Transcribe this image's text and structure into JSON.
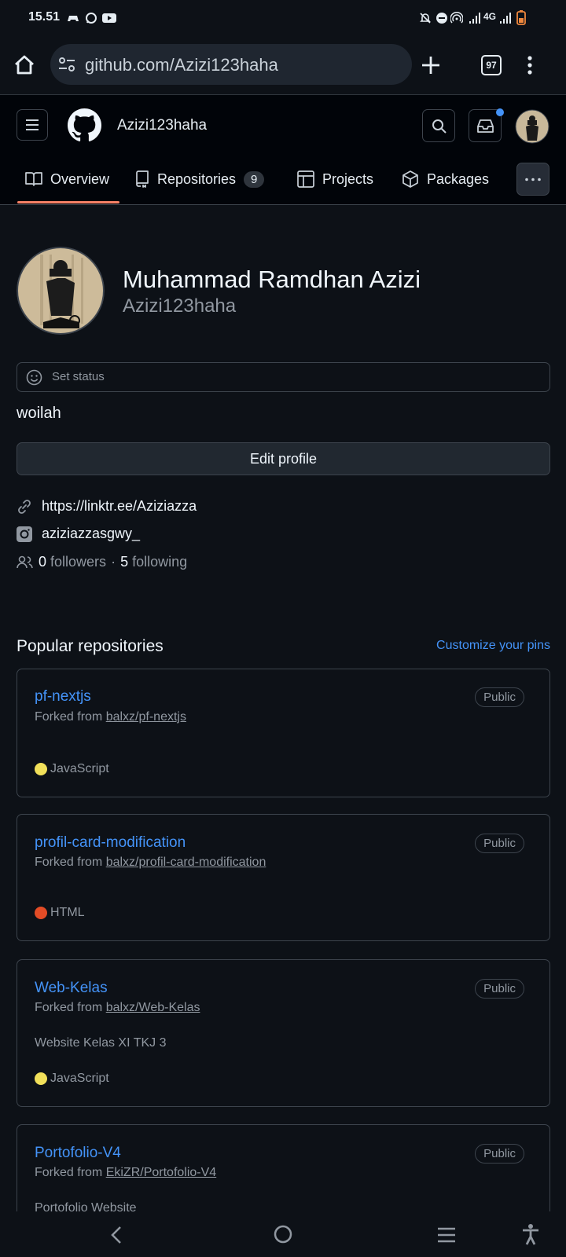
{
  "status_bar": {
    "time": "15.51",
    "network": "4G"
  },
  "browser": {
    "url": "github.com/Azizi123haha",
    "tab_count": "97"
  },
  "header": {
    "username": "Azizi123haha"
  },
  "tabs": [
    {
      "label": "Overview",
      "icon": "book-icon"
    },
    {
      "label": "Repositories",
      "count": "9",
      "icon": "repo-icon"
    },
    {
      "label": "Projects",
      "icon": "table-icon"
    },
    {
      "label": "Packages",
      "icon": "package-icon"
    }
  ],
  "profile": {
    "full_name": "Muhammad Ramdhan Azizi",
    "login": "Azizi123haha",
    "status_placeholder": "Set status",
    "bio": "woilah",
    "edit_label": "Edit profile",
    "link": "https://linktr.ee/Aziziazza",
    "instagram": "aziziazzasgwy_",
    "followers_count": "0",
    "followers_label": "followers",
    "separator": "·",
    "following_count": "5",
    "following_label": "following"
  },
  "popular": {
    "title": "Popular repositories",
    "customize_label": "Customize your pins",
    "forked_prefix": "Forked from",
    "repos": [
      {
        "name": "pf-nextjs",
        "source": "balxz/pf-nextjs",
        "badge": "Public",
        "language": "JavaScript",
        "lang_color": "#f1e05a",
        "description": ""
      },
      {
        "name": "profil-card-modification",
        "source": "balxz/profil-card-modification",
        "badge": "Public",
        "language": "HTML",
        "lang_color": "#e34c26",
        "description": ""
      },
      {
        "name": "Web-Kelas",
        "source": "balxz/Web-Kelas",
        "badge": "Public",
        "language": "JavaScript",
        "lang_color": "#f1e05a",
        "description": "Website Kelas XI TKJ 3"
      },
      {
        "name": "Portofolio-V4",
        "source": "EkiZR/Portofolio-V4",
        "badge": "Public",
        "language": "",
        "lang_color": "",
        "description": "Portofolio Website"
      }
    ]
  }
}
